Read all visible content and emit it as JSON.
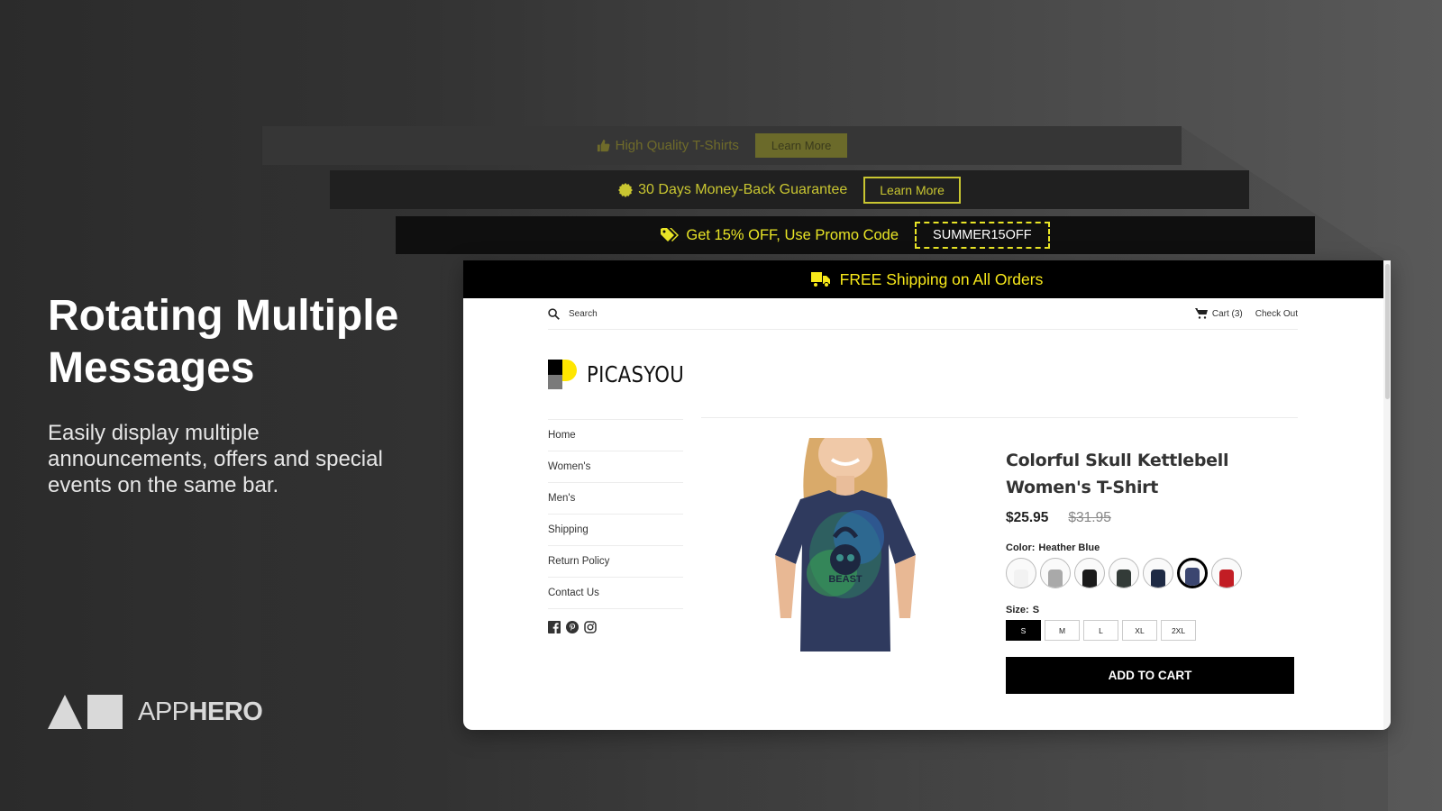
{
  "hero": {
    "title": "Rotating Multiple Messages",
    "subtitle": "Easily display multiple announcements, offers and special events on the same bar."
  },
  "brand": {
    "name_light": "APP",
    "name_bold": "HERO"
  },
  "announcement_bars": [
    {
      "icon": "thumbs-up-icon",
      "text": "High Quality T-Shirts",
      "button_label": "Learn More"
    },
    {
      "icon": "badge-icon",
      "text": "30 Days Money-Back Guarantee",
      "button_label": "Learn More"
    },
    {
      "icon": "tag-icon",
      "text": "Get 15% OFF, Use Promo Code",
      "promo_code": "SUMMER15OFF"
    },
    {
      "icon": "truck-icon",
      "text": "FREE Shipping on All Orders"
    }
  ],
  "colors": {
    "accent_yellow": "#f7e81a",
    "bar_black": "#000000",
    "cart_button": "#000000"
  },
  "store": {
    "search_placeholder": "Search",
    "cart_label": "Cart (3)",
    "checkout_label": "Check Out",
    "logo_text": "PICASYOU",
    "nav": [
      "Home",
      "Women's",
      "Men's",
      "Shipping",
      "Return Policy",
      "Contact Us"
    ],
    "social": [
      "facebook-icon",
      "pinterest-icon",
      "instagram-icon"
    ]
  },
  "product": {
    "title": "Colorful Skull Kettlebell Women's T-Shirt",
    "price": "$25.95",
    "compare_price": "$31.95",
    "color_label": "Color:",
    "color_value": "Heather Blue",
    "swatches": [
      {
        "name": "White",
        "hex": "#f2f2f2"
      },
      {
        "name": "Gray",
        "hex": "#a9a9a9"
      },
      {
        "name": "Black",
        "hex": "#1a1a1a"
      },
      {
        "name": "Charcoal",
        "hex": "#333b38"
      },
      {
        "name": "Navy",
        "hex": "#1e2a44"
      },
      {
        "name": "Heather Blue",
        "hex": "#3b4670",
        "selected": true
      },
      {
        "name": "Red",
        "hex": "#c21d24"
      }
    ],
    "size_label": "Size:",
    "size_value": "S",
    "sizes": [
      "S",
      "M",
      "L",
      "XL",
      "2XL"
    ],
    "selected_size": "S",
    "add_to_cart_label": "ADD TO CART"
  }
}
